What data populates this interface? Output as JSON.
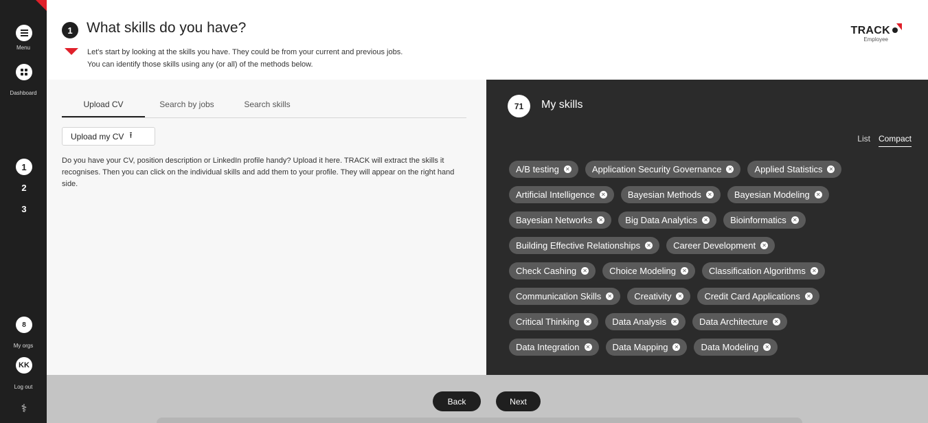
{
  "sidebar": {
    "menu_label": "Menu",
    "dashboard_label": "Dashboard",
    "steps": [
      "1",
      "2",
      "3"
    ],
    "orgs_count": "8",
    "orgs_label": "My orgs",
    "avatar_initials": "KK",
    "logout_label": "Log out"
  },
  "header": {
    "step_badge": "1",
    "title": "What skills do you have?",
    "subtitle_line1": "Let's start by looking at the skills you have. They could be from your current and previous jobs.",
    "subtitle_line2": "You can identify those skills using any (or all) of the methods below.",
    "brand_name": "TRACK",
    "brand_sub": "Employee"
  },
  "left": {
    "tabs": [
      "Upload CV",
      "Search by jobs",
      "Search skills"
    ],
    "active_tab": "Upload CV",
    "upload_button": "Upload my CV",
    "description": "Do you have your CV, position description or LinkedIn profile handy? Upload it here. TRACK will extract the skills it recognises. Then you can click on the individual skills and add them to your profile. They will appear on the right hand side."
  },
  "right": {
    "count": "71",
    "title": "My skills",
    "view_list": "List",
    "view_compact": "Compact",
    "skills": [
      "A/B testing",
      "Application Security Governance",
      "Applied Statistics",
      "Artificial Intelligence",
      "Bayesian Methods",
      "Bayesian Modeling",
      "Bayesian Networks",
      "Big Data Analytics",
      "Bioinformatics",
      "Building Effective Relationships",
      "Career Development",
      "Check Cashing",
      "Choice Modeling",
      "Classification Algorithms",
      "Communication Skills",
      "Creativity",
      "Credit Card Applications",
      "Critical Thinking",
      "Data Analysis",
      "Data Architecture",
      "Data Integration",
      "Data Mapping",
      "Data Modeling"
    ]
  },
  "footer": {
    "back": "Back",
    "next": "Next"
  },
  "colors": {
    "accent_red": "#e0202a",
    "sidebar_bg": "#1f1f1f",
    "panel_dark": "#2b2b2b",
    "chip_bg": "#5a5a5a",
    "footer_bg": "#c4c4c4"
  }
}
